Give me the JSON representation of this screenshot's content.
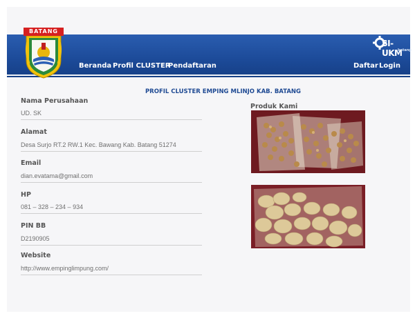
{
  "header": {
    "logo_banner": "BATANG",
    "nav": {
      "home": "Beranda",
      "profile": "Profil CLUSTER",
      "register": "Pendaftaran"
    },
    "right_nav": {
      "signup": "Daftar",
      "login": "Login"
    },
    "brand": {
      "name": "SI-UKM",
      "sub": "batang"
    },
    "colors": {
      "navbar": "#1f4e9c",
      "banner": "#d62020",
      "heading": "#1f4a93"
    }
  },
  "page_title": "PROFIL CLUSTER EMPING MLINJO KAB. BATANG",
  "fields": [
    {
      "label": "Nama Perusahaan",
      "value": "UD. SK"
    },
    {
      "label": "Alamat",
      "value": "Desa Surjo RT.2 RW.1 Kec. Bawang Kab. Batang 51274"
    },
    {
      "label": "Email",
      "value": "dian.evatama@gmail.com"
    },
    {
      "label": "HP",
      "value": "081 – 328 – 234 – 934"
    },
    {
      "label": "PIN BB",
      "value": "D2190905"
    },
    {
      "label": "Website",
      "value": "http://www.empinglimpung.com/"
    }
  ],
  "produk": {
    "label": "Produk Kami"
  }
}
